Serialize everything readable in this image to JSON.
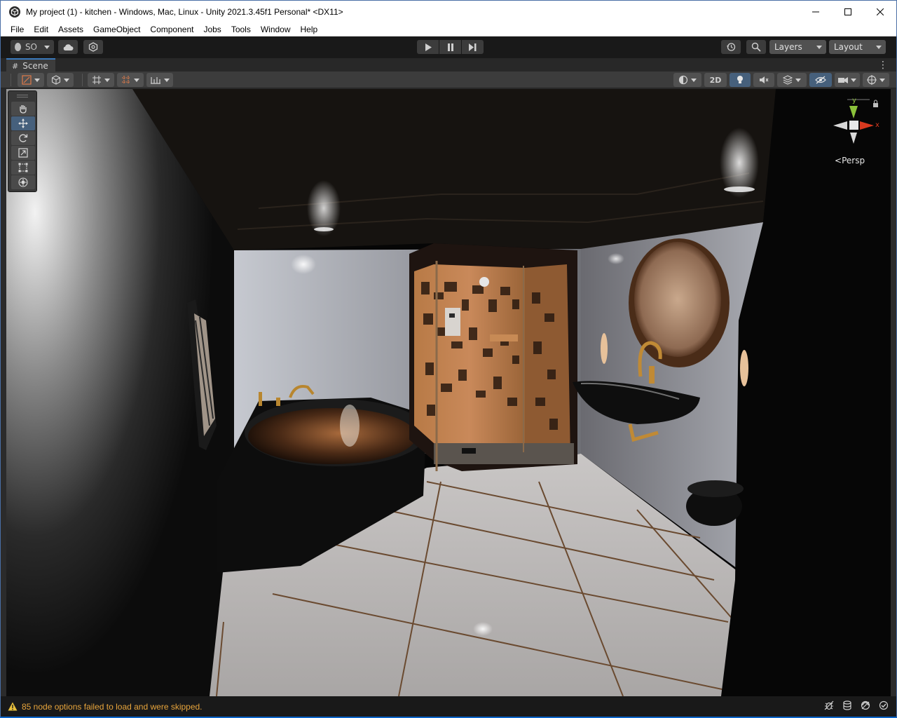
{
  "window": {
    "title": "My project (1) - kitchen - Windows, Mac, Linux - Unity 2021.3.45f1 Personal* <DX11>",
    "controls": [
      "minimize",
      "maximize",
      "close"
    ]
  },
  "menu": [
    "File",
    "Edit",
    "Assets",
    "GameObject",
    "Component",
    "Jobs",
    "Tools",
    "Window",
    "Help"
  ],
  "toolbar": {
    "account_label": "SO",
    "layers_label": "Layers",
    "layout_label": "Layout"
  },
  "scene_tab": {
    "label": "Scene"
  },
  "scene_toolbar": {
    "two_d_label": "2D"
  },
  "gizmo": {
    "y_label": "y",
    "x_label": "x",
    "projection_label": "Persp"
  },
  "status": {
    "message": "85 node options failed to load and were skipped."
  },
  "colors": {
    "accent_blue": "#3a79bb",
    "warning": "#e8a53c",
    "gizmo_x": "#d8391f",
    "gizmo_y": "#8bc23a"
  }
}
